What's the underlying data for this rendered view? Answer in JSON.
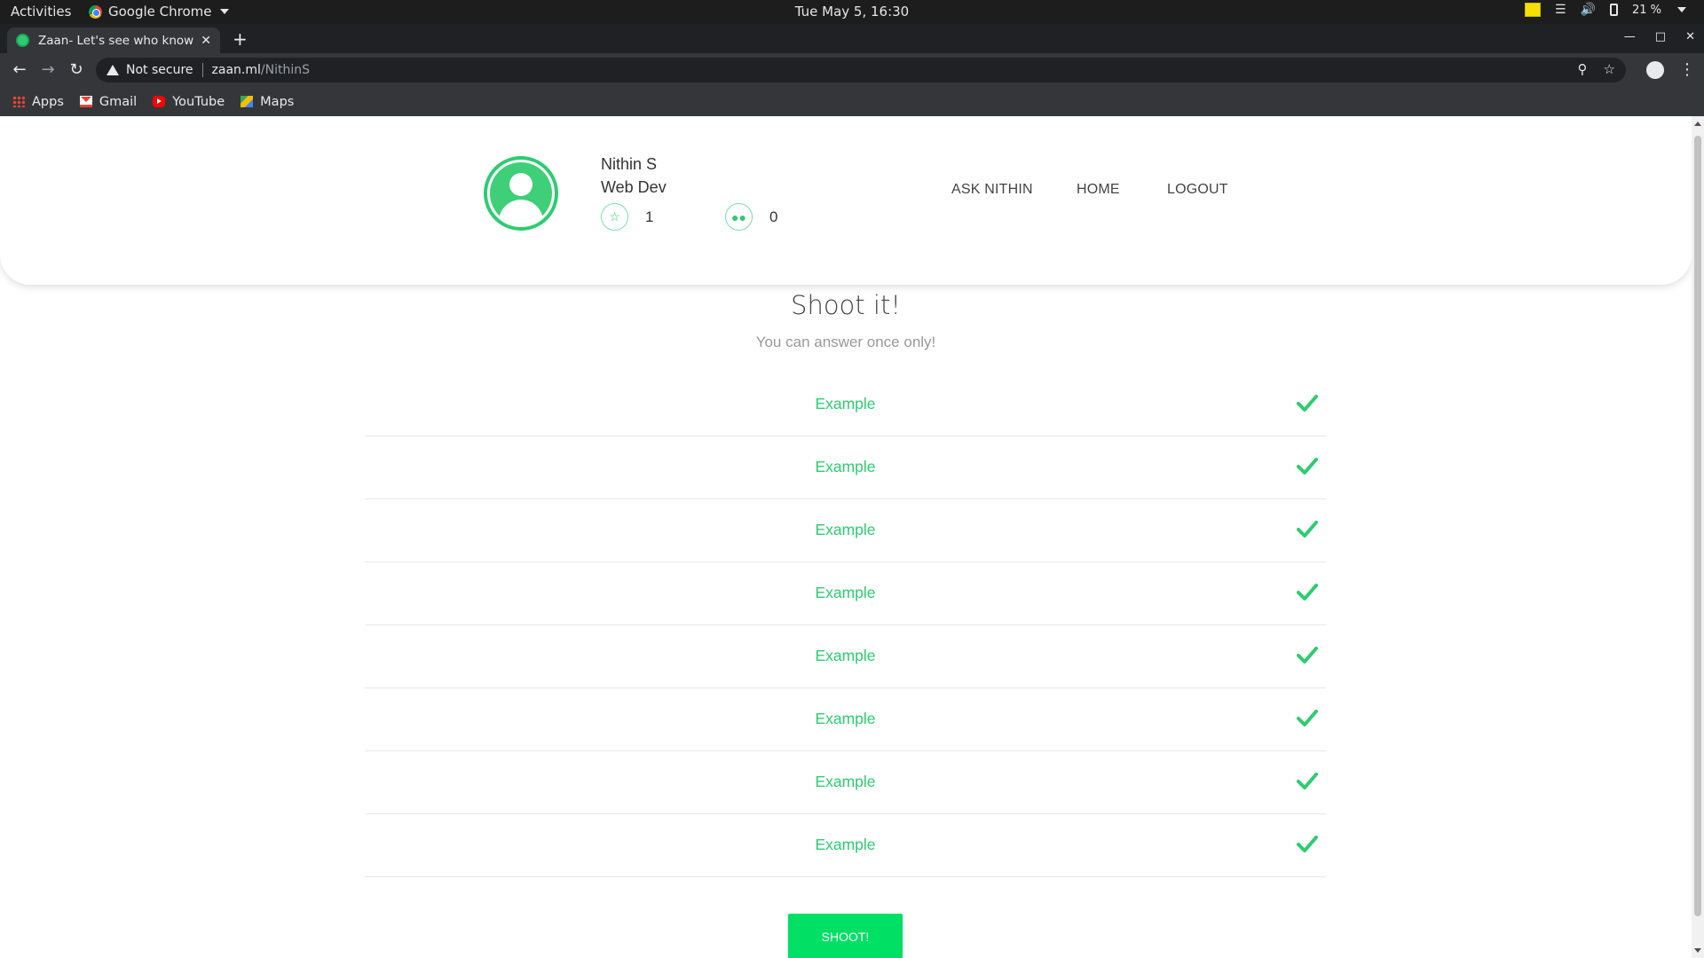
{
  "system": {
    "activities": "Activities",
    "app_name": "Google Chrome",
    "clock": "Tue May  5, 16:30",
    "battery": "21 %"
  },
  "browser": {
    "tab_title": "Zaan- Let's see who know",
    "url_security": "Not secure",
    "url_host": "zaan.ml",
    "url_path": "/NithinS",
    "bookmarks": [
      "Apps",
      "Gmail",
      "YouTube",
      "Maps"
    ]
  },
  "profile": {
    "name": "Nithin S",
    "role": "Web Dev",
    "stars": "1",
    "followers": "0"
  },
  "nav": {
    "ask": "ASK NITHIN",
    "home": "HOME",
    "logout": "LOGOUT"
  },
  "quiz": {
    "title": "Shoot it!",
    "subtitle": "You can answer once only!",
    "options": [
      "Example",
      "Example",
      "Example",
      "Example",
      "Example",
      "Example",
      "Example",
      "Example"
    ],
    "submit_label": "SHOOT!"
  },
  "colors": {
    "accent": "#2ecc71",
    "button": "#00e065"
  }
}
